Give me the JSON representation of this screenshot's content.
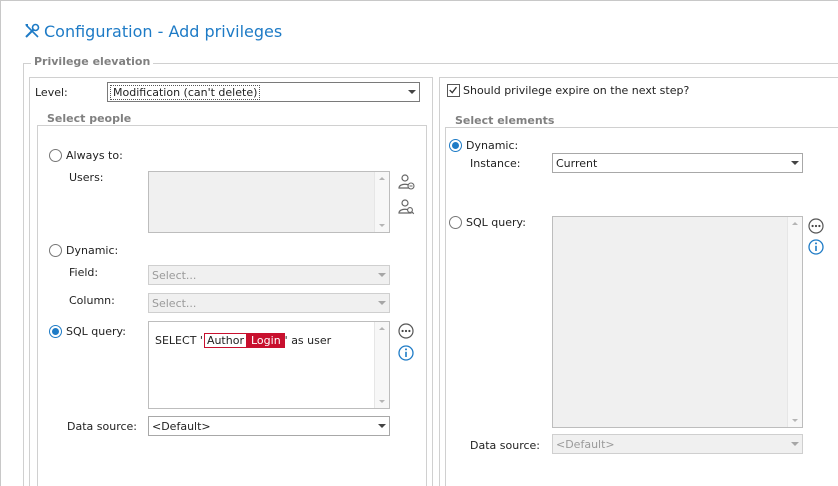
{
  "window": {
    "title": "Configuration - Add privileges",
    "title_icon": "tools-icon"
  },
  "privilege_elevation": {
    "legend": "Privilege elevation",
    "level_label": "Level:",
    "level_value": "Modification (can't delete)",
    "expire_label": "Should privilege expire on the next step?",
    "expire_checked": true
  },
  "select_people": {
    "legend": "Select people",
    "always_to_label": "Always to:",
    "users_label": "Users:",
    "dynamic_label": "Dynamic:",
    "field_label": "Field:",
    "field_placeholder": "Select...",
    "column_label": "Column:",
    "column_placeholder": "Select...",
    "sql_label": "SQL query:",
    "sql_prefix": "SELECT '",
    "sql_token_author": "Author",
    "sql_token_login": "Login",
    "sql_suffix": "' as user",
    "datasource_label": "Data source:",
    "datasource_value": "<Default>",
    "selected_mode": "sql"
  },
  "select_elements": {
    "legend": "Select elements",
    "dynamic_label": "Dynamic:",
    "instance_label": "Instance:",
    "instance_value": "Current",
    "sql_label": "SQL query:",
    "datasource_label": "Data source:",
    "datasource_value": "<Default>",
    "selected_mode": "dynamic"
  },
  "colors": {
    "accent": "#1e7bc6",
    "token_red": "#c8102e"
  }
}
